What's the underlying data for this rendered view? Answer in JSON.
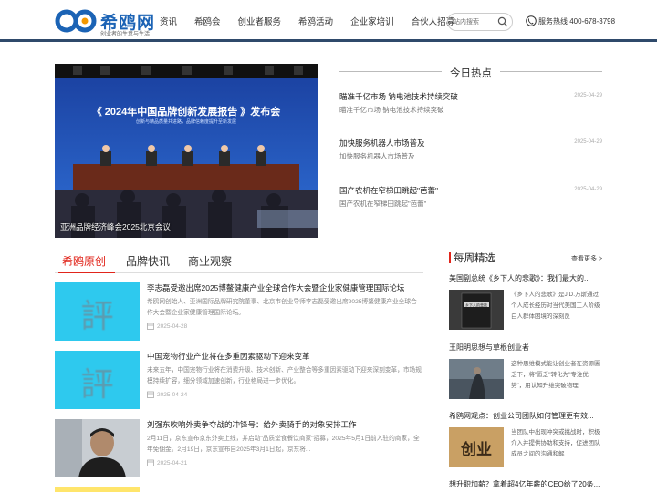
{
  "header": {
    "logo_text": "希鸥网",
    "logo_sub": "创业者的生意与生活",
    "nav": [
      "资讯",
      "希鸥会",
      "创业者服务",
      "希鸥活动",
      "企业家培训",
      "合伙人招募"
    ],
    "search_placeholder": "站内搜索",
    "hotline": "服务热线 400-678-3798"
  },
  "banner": {
    "title": "《 2024年中国品牌创新发展报告 》发布会",
    "subtitle": "创新与精品质量共进路，品牌信赖度提升至新发展",
    "caption": "亚洲品牌经济峰会2025北京会议"
  },
  "hot": {
    "title": "今日热点",
    "items": [
      {
        "title": "瞄准千亿市场 钠电池技术持续突破",
        "sub": "瞄准千亿市场 钠电池技术持续突破",
        "date": "2025-04-29"
      },
      {
        "title": "加快服务机器人市场普及",
        "sub": "加快服务机器人市场普及",
        "date": "2025-04-29"
      },
      {
        "title": "国产农机在窄梯田跳起\"芭蕾\"",
        "sub": "国产农机在窄梯田跳起\"芭蕾\"",
        "date": "2025-04-29"
      }
    ]
  },
  "tabs": [
    "希鸥原创",
    "品牌快讯",
    "商业观察"
  ],
  "articles": [
    {
      "glyph": "評",
      "title": "李志磊受邀出席2025博鳌健康产业全球合作大会暨企业家健康管理国际论坛",
      "desc": "希鸥网创始人、亚洲国际品牌研究院董事、北京市创业导师李志磊受邀出席2025博鳌健康产业全球合作大会暨企业家健康管理国际论坛。",
      "date": "2025-04-28"
    },
    {
      "glyph": "評",
      "title": "中国宠物行业产业将在多重因素驱动下迎来变革",
      "desc": "未来五年，中国宠物行业将在消费升级、技术创新、产业整合等多重因素驱动下迎来深刻变革，市场规模持续扩容，细分领域加速创新，行业格局进一步优化。",
      "date": "2025-04-24"
    },
    {
      "glyph": "",
      "title": "刘强东吹响外卖争夺战的冲锋号：给外卖骑手的对象安排工作",
      "desc": "2月11日，京东宣布京东外卖上线，并启动\"品质堂食餐饮商家\"招募，2025年5月1日前入驻的商家，全年免佣金。2月19日，京东宣布自2025年3月1日起，京东将...",
      "date": "2025-04-21"
    }
  ],
  "weekly": {
    "title": "每周精选",
    "more": "查看更多 >",
    "items": [
      {
        "title": "美国副总统《乡下人的悲歌》：我们最大的...",
        "desc": "《乡下人的悲歌》是J.D.万斯通过个人成长经历对当代美国工人阶级白人群体困境的深刻反",
        "thumb_text": "乡下人的悲歌"
      },
      {
        "title": "王阳明思想与草根创业者",
        "desc": "这种思维模式能让创业者在资源匮乏下，将\"匮乏\"转化为\"专注优势\"，用认知升维突破物理",
        "thumb_text": ""
      },
      {
        "title": "希鸥网观点：创业公司团队如何管理更有效...",
        "desc": "当团队中出现冲突或挑战时，积极介入并提供协助和支持，促进团队成员之间的沟通和解",
        "thumb_text": "创业"
      }
    ],
    "last_title": "想升职加薪？拿着超4亿年薪的CEO给了20条..."
  },
  "colors": {
    "brand_blue": "#1b63b5",
    "accent_red": "#e1251b",
    "header_line": "#2f4a6b",
    "thumb_cyan": "#2ec9ee"
  }
}
